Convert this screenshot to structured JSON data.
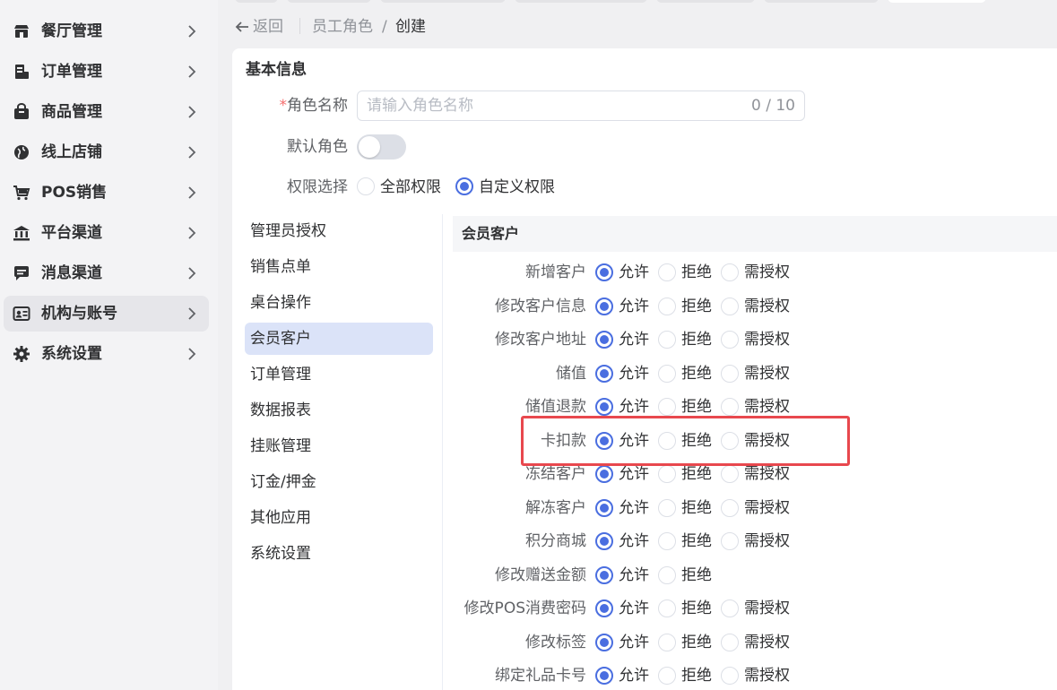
{
  "sidebar": {
    "items": [
      {
        "label": "餐厅管理",
        "icon": "restaurant-icon"
      },
      {
        "label": "订单管理",
        "icon": "order-icon"
      },
      {
        "label": "商品管理",
        "icon": "product-icon"
      },
      {
        "label": "线上店铺",
        "icon": "globe-icon"
      },
      {
        "label": "POS销售",
        "icon": "cart-icon"
      },
      {
        "label": "平台渠道",
        "icon": "bank-icon"
      },
      {
        "label": "消息渠道",
        "icon": "chat-icon"
      },
      {
        "label": "机构与账号",
        "icon": "id-card-icon"
      },
      {
        "label": "系统设置",
        "icon": "gear-icon"
      }
    ],
    "active_item": "机构与账号"
  },
  "breadcrumb": {
    "back": "返回",
    "parent": "员工角色",
    "separator": "/",
    "current": "创建"
  },
  "form": {
    "section_title": "基本信息",
    "role_name": {
      "required_mark": "*",
      "label": "角色名称",
      "placeholder": "请输入角色名称",
      "value": "",
      "counter": "0 / 10"
    },
    "default_role": {
      "label": "默认角色",
      "enabled": false
    },
    "permission_select": {
      "label": "权限选择",
      "options": [
        "全部权限",
        "自定义权限"
      ],
      "selected": "自定义权限"
    }
  },
  "categories": {
    "items": [
      "管理员授权",
      "销售点单",
      "桌台操作",
      "会员客户",
      "订单管理",
      "数据报表",
      "挂账管理",
      "订金/押金",
      "其他应用",
      "系统设置"
    ],
    "active": "会员客户"
  },
  "permissions": {
    "section_title": "会员客户",
    "options": {
      "allow": "允许",
      "deny": "拒绝",
      "auth": "需授权"
    },
    "rows": [
      {
        "label": "新增客户",
        "selected": "允许",
        "has_auth": true
      },
      {
        "label": "修改客户信息",
        "selected": "允许",
        "has_auth": true
      },
      {
        "label": "修改客户地址",
        "selected": "允许",
        "has_auth": true
      },
      {
        "label": "储值",
        "selected": "允许",
        "has_auth": true
      },
      {
        "label": "储值退款",
        "selected": "允许",
        "has_auth": true
      },
      {
        "label": "卡扣款",
        "selected": "允许",
        "has_auth": true
      },
      {
        "label": "冻结客户",
        "selected": "允许",
        "has_auth": true
      },
      {
        "label": "解冻客户",
        "selected": "允许",
        "has_auth": true
      },
      {
        "label": "积分商城",
        "selected": "允许",
        "has_auth": true
      },
      {
        "label": "修改赠送金额",
        "selected": "允许",
        "has_auth": false
      },
      {
        "label": "修改POS消费密码",
        "selected": "允许",
        "has_auth": true
      },
      {
        "label": "修改标签",
        "selected": "允许",
        "has_auth": true
      },
      {
        "label": "绑定礼品卡号",
        "selected": "允许",
        "has_auth": true
      }
    ],
    "highlighted_row": "卡扣款"
  },
  "colors": {
    "accent": "#4a6ee0",
    "highlight": "#e8484e",
    "required": "#f56c6c",
    "active_category_bg": "#dbe3f8"
  }
}
